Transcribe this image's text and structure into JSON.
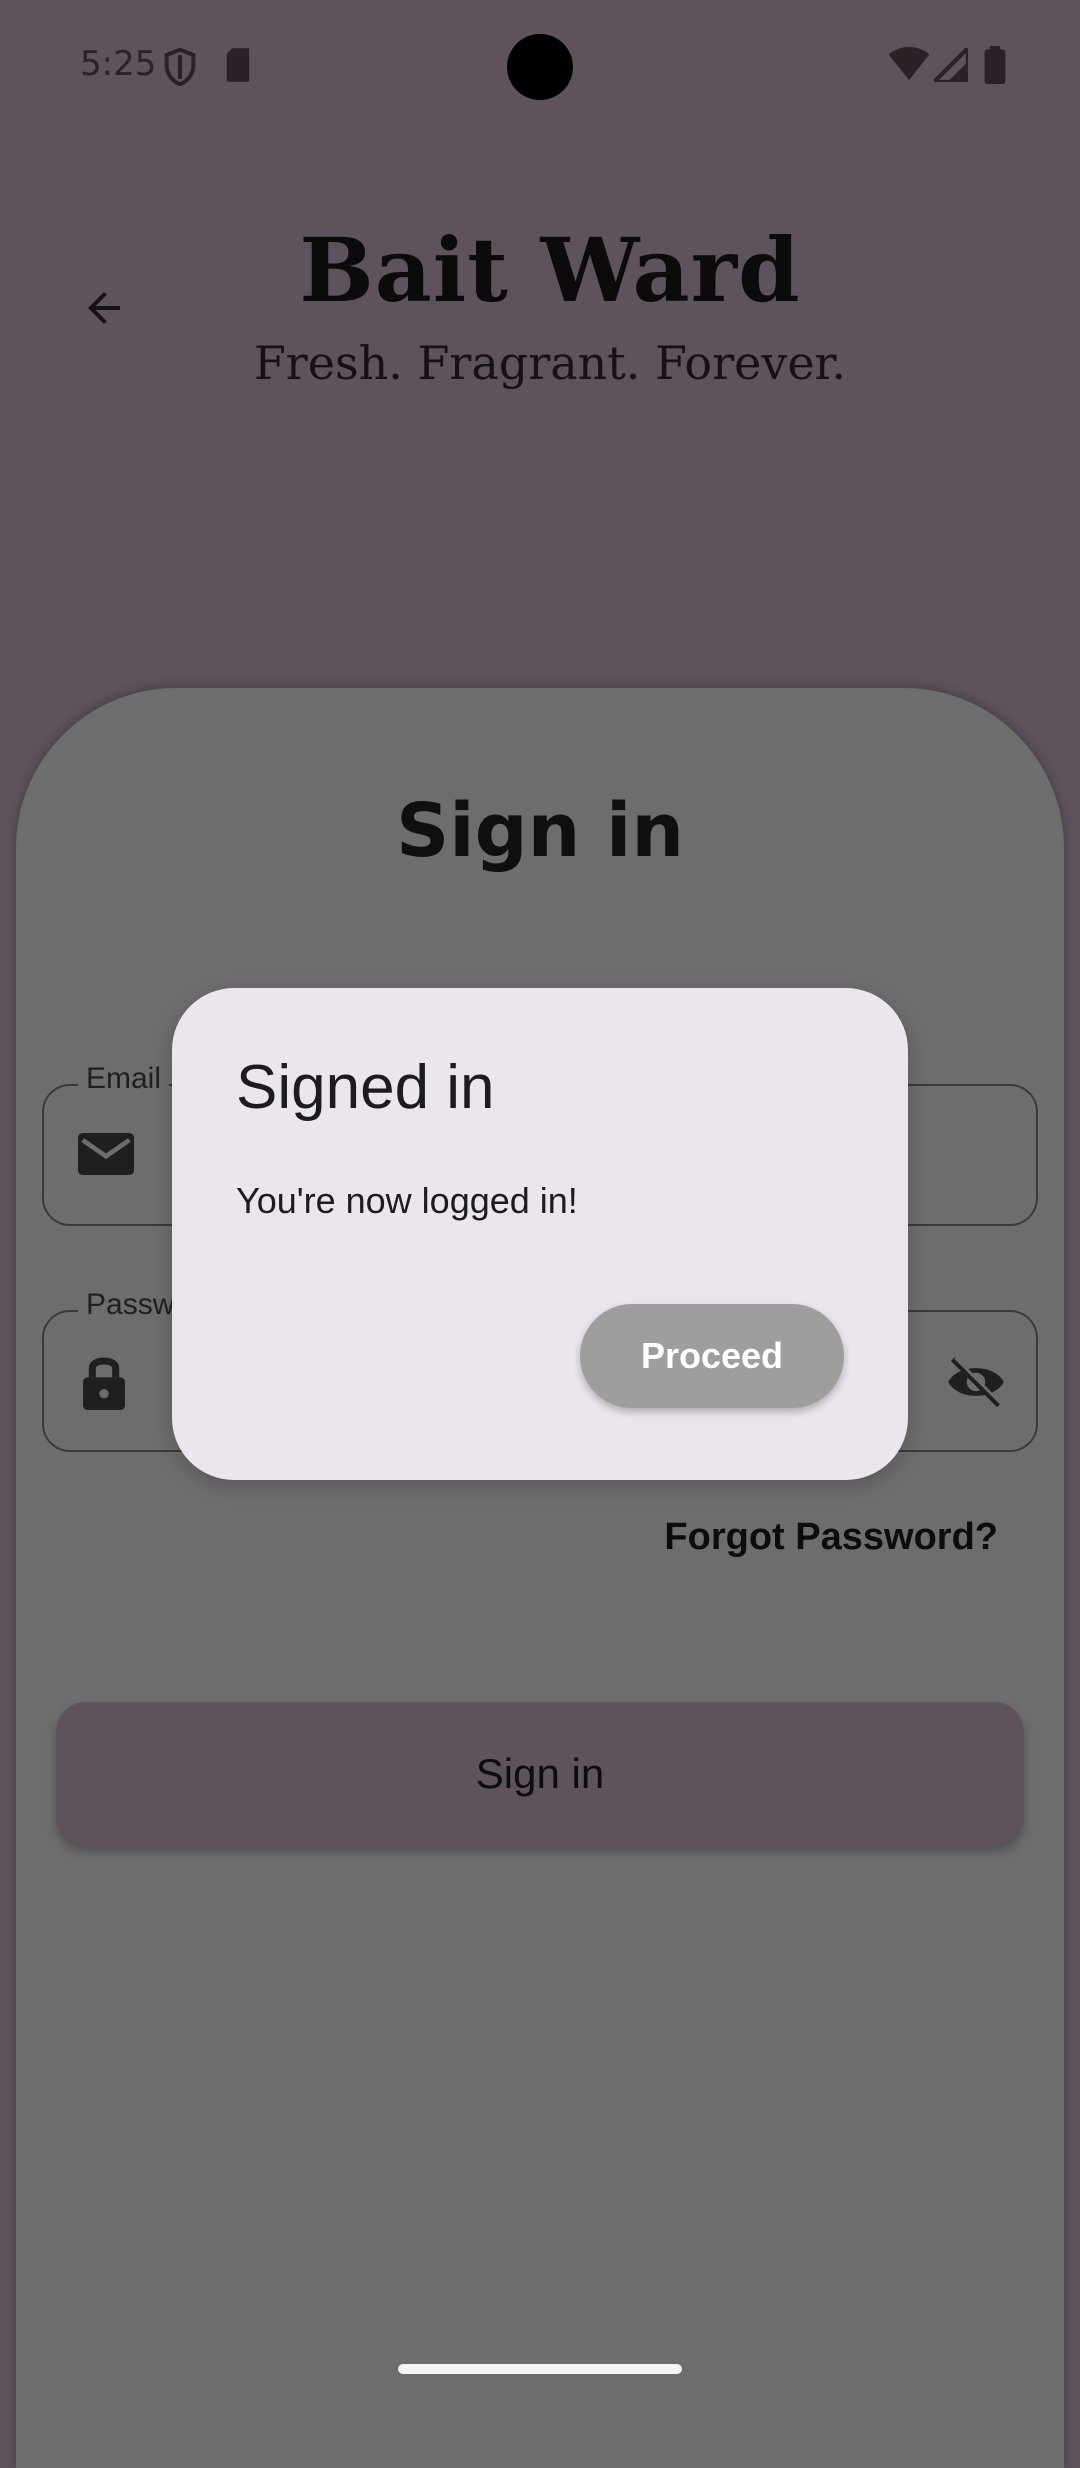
{
  "status_bar": {
    "time": "5:25",
    "icons": [
      "shield-icon",
      "sd-card-icon",
      "wifi-icon",
      "signal-icon",
      "battery-icon"
    ]
  },
  "header": {
    "back_icon": "arrow-back-icon",
    "title": "Bait  Ward",
    "subtitle": "Fresh. Fragrant. Forever."
  },
  "signin_card": {
    "title": "Sign in",
    "email_field": {
      "label": "Email",
      "value": "",
      "icon": "mail-icon"
    },
    "password_field": {
      "label": "Password",
      "value": "",
      "icon": "lock-icon",
      "toggle_icon": "visibility-off-icon"
    },
    "forgot_password": "Forgot Password?",
    "signin_button": "Sign in"
  },
  "dialog": {
    "title": "Signed in",
    "message": "You're now logged in!",
    "proceed_button": "Proceed"
  },
  "colors": {
    "background": "#5e525c",
    "card": "#6d6d6d",
    "dialog": "#ebe5ee",
    "proceed_button": "#9e9e9e"
  }
}
